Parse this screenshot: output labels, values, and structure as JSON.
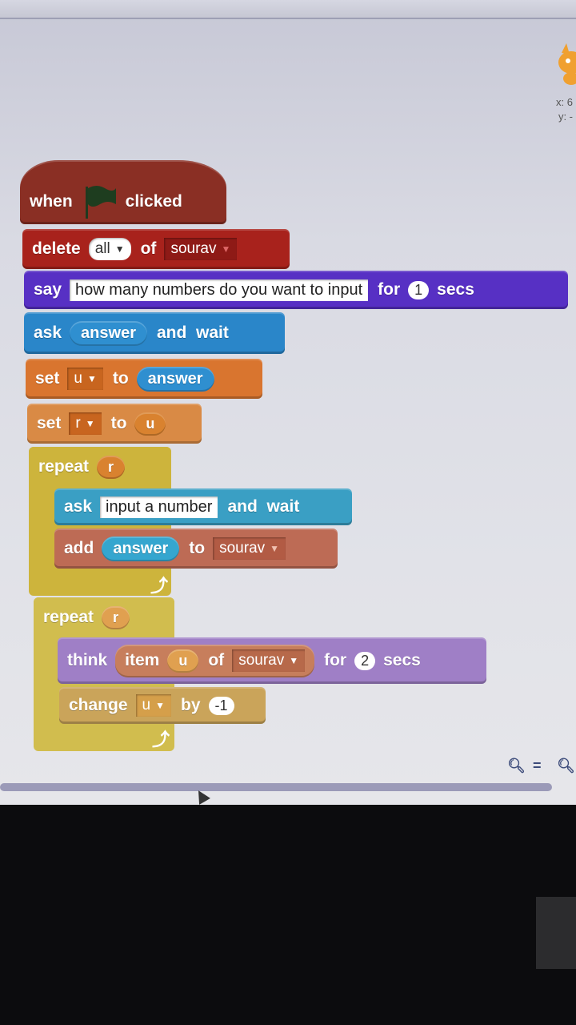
{
  "sprite": {
    "x_label": "x: 6",
    "y_label": "y: -"
  },
  "script": {
    "when_flag": {
      "when": "when",
      "clicked": "clicked"
    },
    "delete": {
      "label": "delete",
      "index": "all",
      "of": "of",
      "list": "sourav"
    },
    "say": {
      "label": "say",
      "message": "how many numbers do you want to input",
      "for": "for",
      "secs_value": "1",
      "secs": "secs"
    },
    "ask1": {
      "label": "ask",
      "reporter": "answer",
      "and_wait": "and  wait"
    },
    "set_u": {
      "label": "set",
      "var": "u",
      "to": "to",
      "value": "answer"
    },
    "set_r": {
      "label": "set",
      "var": "r",
      "to": "to",
      "value": "u"
    },
    "repeat1": {
      "label": "repeat",
      "count": "r"
    },
    "ask2": {
      "label": "ask",
      "question": "input a number",
      "and_wait": "and  wait"
    },
    "add": {
      "label": "add",
      "value": "answer",
      "to": "to",
      "list": "sourav"
    },
    "repeat2": {
      "label": "repeat",
      "count": "r"
    },
    "think": {
      "label": "think",
      "item": "item",
      "index": "u",
      "of": "of",
      "list": "sourav",
      "for": "for",
      "secs_value": "2",
      "secs": "secs"
    },
    "change": {
      "label": "change",
      "var": "u",
      "by": "by",
      "value": "-1"
    }
  },
  "zoom": {
    "zoom_out": "zoom-out-icon",
    "reset": "=",
    "zoom_in": "zoom-in-icon"
  },
  "colors": {
    "events": "#8a2f24",
    "lists": "#a8221c",
    "looks": "#5730c4",
    "sensing": "#2a86c9",
    "variables": "#d9752f",
    "control": "#cdb43c"
  }
}
